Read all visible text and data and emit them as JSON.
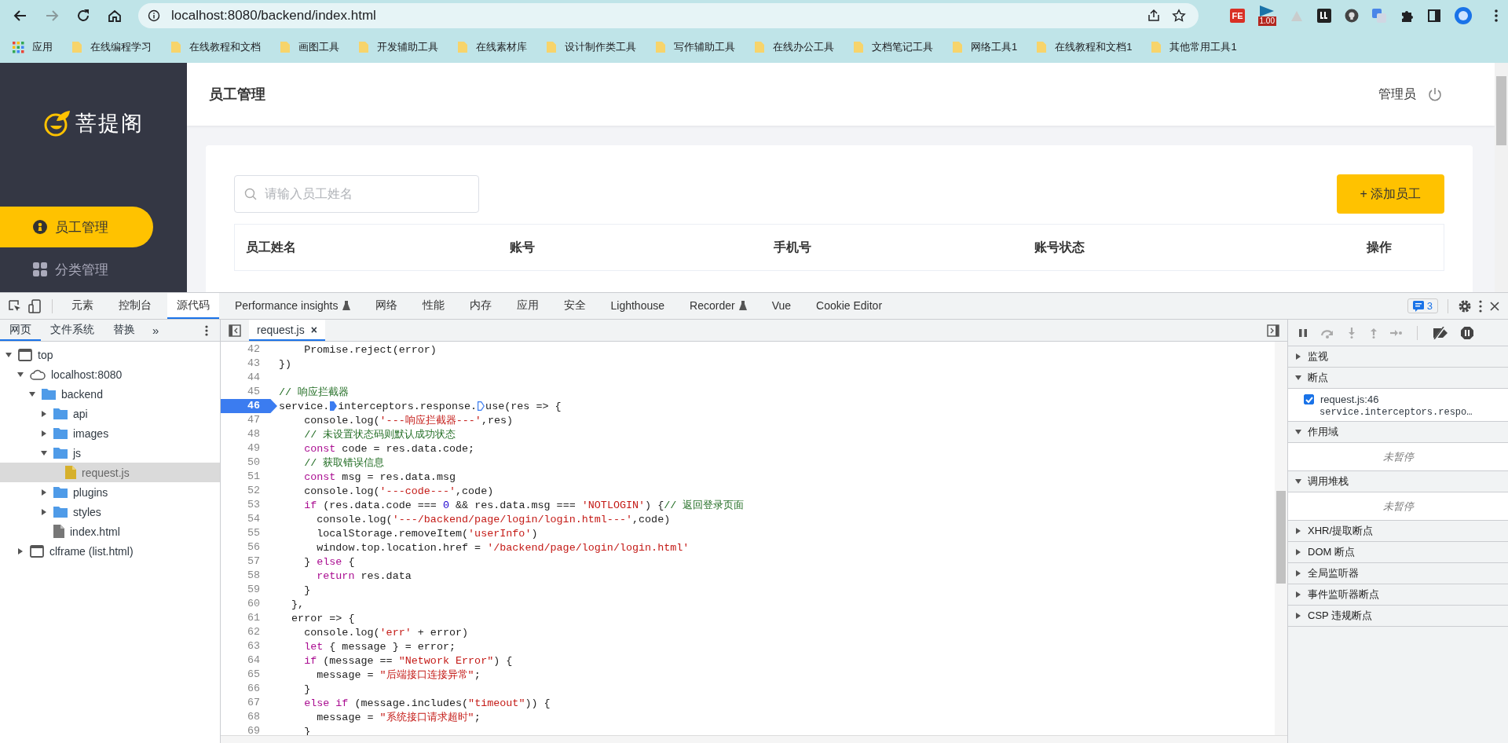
{
  "browser": {
    "nav_buttons": [
      {
        "kind": "back",
        "disabled": false
      },
      {
        "kind": "forward",
        "disabled": true
      },
      {
        "kind": "reload",
        "disabled": false
      },
      {
        "kind": "home",
        "disabled": false
      }
    ],
    "url": "localhost:8080/backend/index.html",
    "extensions": [
      {
        "kind": "fe",
        "label": "FE"
      },
      {
        "kind": "meter",
        "badge": "1.00"
      },
      {
        "kind": "triangle"
      },
      {
        "kind": "square"
      },
      {
        "kind": "bulb"
      },
      {
        "kind": "translate"
      },
      {
        "kind": "puzzle"
      },
      {
        "kind": "sidebar"
      },
      {
        "kind": "profile"
      }
    ],
    "bookmarks": {
      "apps_label": "应用",
      "folders": [
        "在线编程学习",
        "在线教程和文档",
        "画图工具",
        "开发辅助工具",
        "在线素材库",
        "设计制作类工具",
        "写作辅助工具",
        "在线办公工具",
        "文档笔记工具",
        "网络工具1",
        "在线教程和文档1",
        "其他常用工具1"
      ]
    }
  },
  "app": {
    "logo": "菩提阁",
    "nav": [
      {
        "label": "员工管理",
        "selected": true
      },
      {
        "label": "分类管理",
        "selected": false
      }
    ],
    "page_title": "员工管理",
    "user": "管理员",
    "search": {
      "placeholder": "请输入员工姓名"
    },
    "add_button": "+ 添加员工",
    "table": {
      "columns": [
        "员工姓名",
        "账号",
        "手机号",
        "账号状态",
        "操作"
      ]
    }
  },
  "devtools": {
    "tabs": [
      {
        "label": "元素",
        "selected": false,
        "experimental": false
      },
      {
        "label": "控制台",
        "selected": false,
        "experimental": false
      },
      {
        "label": "源代码",
        "selected": true,
        "experimental": false
      },
      {
        "label": "Performance insights",
        "selected": false,
        "experimental": true
      },
      {
        "label": "网络",
        "selected": false,
        "experimental": false
      },
      {
        "label": "性能",
        "selected": false,
        "experimental": false
      },
      {
        "label": "内存",
        "selected": false,
        "experimental": false
      },
      {
        "label": "应用",
        "selected": false,
        "experimental": false
      },
      {
        "label": "安全",
        "selected": false,
        "experimental": false
      },
      {
        "label": "Lighthouse",
        "selected": false,
        "experimental": false
      },
      {
        "label": "Recorder",
        "selected": false,
        "experimental": true
      },
      {
        "label": "Vue",
        "selected": false,
        "experimental": false
      },
      {
        "label": "Cookie Editor",
        "selected": false,
        "experimental": false
      }
    ],
    "issues_count": "3",
    "navigator": {
      "tabs": [
        {
          "label": "网页",
          "selected": true
        },
        {
          "label": "文件系统",
          "selected": false
        },
        {
          "label": "替换",
          "selected": false
        }
      ],
      "more": "»",
      "tree": [
        {
          "label": "top",
          "kind": "frame",
          "expanded": true,
          "selected": false,
          "children": [
            {
              "label": "localhost:8080",
              "kind": "origin",
              "expanded": true,
              "selected": false,
              "children": [
                {
                  "label": "backend",
                  "kind": "folder",
                  "expanded": true,
                  "selected": false,
                  "children": [
                    {
                      "label": "api",
                      "kind": "folder",
                      "expanded": false,
                      "selected": false
                    },
                    {
                      "label": "images",
                      "kind": "folder",
                      "expanded": false,
                      "selected": false
                    },
                    {
                      "label": "js",
                      "kind": "folder",
                      "expanded": true,
                      "selected": false,
                      "children": [
                        {
                          "label": "request.js",
                          "kind": "script",
                          "selected": true
                        }
                      ]
                    },
                    {
                      "label": "plugins",
                      "kind": "folder",
                      "expanded": false,
                      "selected": false
                    },
                    {
                      "label": "styles",
                      "kind": "folder",
                      "expanded": false,
                      "selected": false
                    },
                    {
                      "label": "index.html",
                      "kind": "file",
                      "selected": false
                    }
                  ]
                }
              ]
            },
            {
              "label": "clframe (list.html)",
              "kind": "frame",
              "expanded": false,
              "selected": false
            }
          ]
        }
      ]
    },
    "editor": {
      "tabs": [
        {
          "label": "request.js",
          "close": "×"
        }
      ],
      "lines": [
        {
          "number": "42",
          "breakpoint": false,
          "tokens": [
            {
              "kind": "plain",
              "text": "    Promise.reject(error)"
            }
          ]
        },
        {
          "number": "43",
          "breakpoint": false,
          "tokens": [
            {
              "kind": "plain",
              "text": "})"
            }
          ]
        },
        {
          "number": "44",
          "breakpoint": false
        },
        {
          "number": "45",
          "breakpoint": false,
          "tokens": [
            {
              "kind": "comment",
              "text": "// 响应拦截器"
            }
          ]
        },
        {
          "number": "46",
          "breakpoint": true,
          "tokens": [
            {
              "kind": "plain",
              "text": "service."
            },
            {
              "kind": "marker",
              "active": true
            },
            {
              "kind": "plain",
              "text": "interceptors.response."
            },
            {
              "kind": "marker",
              "active": false
            },
            {
              "kind": "plain",
              "text": "use(res => {"
            }
          ]
        },
        {
          "number": "47",
          "breakpoint": false,
          "tokens": [
            {
              "kind": "plain",
              "text": "    console.log("
            },
            {
              "kind": "string",
              "text": "'---响应拦截器---'"
            },
            {
              "kind": "plain",
              "text": ",res)"
            }
          ]
        },
        {
          "number": "48",
          "breakpoint": false,
          "tokens": [
            {
              "kind": "comment",
              "text": "    // 未设置状态码则默认成功状态"
            }
          ]
        },
        {
          "number": "49",
          "breakpoint": false,
          "tokens": [
            {
              "kind": "keyword",
              "text": "    const"
            },
            {
              "kind": "plain",
              "text": " code = res.data.code;"
            }
          ]
        },
        {
          "number": "50",
          "breakpoint": false,
          "tokens": [
            {
              "kind": "comment",
              "text": "    // 获取错误信息"
            }
          ]
        },
        {
          "number": "51",
          "breakpoint": false,
          "tokens": [
            {
              "kind": "keyword",
              "text": "    const"
            },
            {
              "kind": "plain",
              "text": " msg = res.data.msg"
            }
          ]
        },
        {
          "number": "52",
          "breakpoint": false,
          "tokens": [
            {
              "kind": "plain",
              "text": "    console.log("
            },
            {
              "kind": "string",
              "text": "'---code---'"
            },
            {
              "kind": "plain",
              "text": ",code)"
            }
          ]
        },
        {
          "number": "53",
          "breakpoint": false,
          "tokens": [
            {
              "kind": "keyword",
              "text": "    if"
            },
            {
              "kind": "plain",
              "text": " (res.data.code === "
            },
            {
              "kind": "number",
              "text": "0"
            },
            {
              "kind": "plain",
              "text": " && res.data.msg === "
            },
            {
              "kind": "string",
              "text": "'NOTLOGIN'"
            },
            {
              "kind": "plain",
              "text": ") {"
            },
            {
              "kind": "comment",
              "text": "// 返回登录页面"
            }
          ]
        },
        {
          "number": "54",
          "breakpoint": false,
          "tokens": [
            {
              "kind": "plain",
              "text": "      console.log("
            },
            {
              "kind": "string",
              "text": "'---/backend/page/login/login.html---'"
            },
            {
              "kind": "plain",
              "text": ",code)"
            }
          ]
        },
        {
          "number": "55",
          "breakpoint": false,
          "tokens": [
            {
              "kind": "plain",
              "text": "      localStorage.removeItem("
            },
            {
              "kind": "string",
              "text": "'userInfo'"
            },
            {
              "kind": "plain",
              "text": ")"
            }
          ]
        },
        {
          "number": "56",
          "breakpoint": false,
          "tokens": [
            {
              "kind": "plain",
              "text": "      window.top.location.href = "
            },
            {
              "kind": "string",
              "text": "'/backend/page/login/login.html'"
            }
          ]
        },
        {
          "number": "57",
          "breakpoint": false,
          "tokens": [
            {
              "kind": "plain",
              "text": "    } "
            },
            {
              "kind": "keyword",
              "text": "else"
            },
            {
              "kind": "plain",
              "text": " {"
            }
          ]
        },
        {
          "number": "58",
          "breakpoint": false,
          "tokens": [
            {
              "kind": "keyword",
              "text": "      return"
            },
            {
              "kind": "plain",
              "text": " res.data"
            }
          ]
        },
        {
          "number": "59",
          "breakpoint": false,
          "tokens": [
            {
              "kind": "plain",
              "text": "    }"
            }
          ]
        },
        {
          "number": "60",
          "breakpoint": false,
          "tokens": [
            {
              "kind": "plain",
              "text": "  },"
            }
          ]
        },
        {
          "number": "61",
          "breakpoint": false,
          "tokens": [
            {
              "kind": "plain",
              "text": "  error => {"
            }
          ]
        },
        {
          "number": "62",
          "breakpoint": false,
          "tokens": [
            {
              "kind": "plain",
              "text": "    console.log("
            },
            {
              "kind": "string",
              "text": "'err'"
            },
            {
              "kind": "plain",
              "text": " + error)"
            }
          ]
        },
        {
          "number": "63",
          "breakpoint": false,
          "tokens": [
            {
              "kind": "keyword",
              "text": "    let"
            },
            {
              "kind": "plain",
              "text": " { message } = error;"
            }
          ]
        },
        {
          "number": "64",
          "breakpoint": false,
          "tokens": [
            {
              "kind": "keyword",
              "text": "    if"
            },
            {
              "kind": "plain",
              "text": " (message == "
            },
            {
              "kind": "string",
              "text": "\"Network Error\""
            },
            {
              "kind": "plain",
              "text": ") {"
            }
          ]
        },
        {
          "number": "65",
          "breakpoint": false,
          "tokens": [
            {
              "kind": "plain",
              "text": "      message = "
            },
            {
              "kind": "string",
              "text": "\"后端接口连接异常\""
            },
            {
              "kind": "plain",
              "text": ";"
            }
          ]
        },
        {
          "number": "66",
          "breakpoint": false,
          "tokens": [
            {
              "kind": "plain",
              "text": "    }"
            }
          ]
        },
        {
          "number": "67",
          "breakpoint": false,
          "tokens": [
            {
              "kind": "keyword",
              "text": "    else if"
            },
            {
              "kind": "plain",
              "text": " (message.includes("
            },
            {
              "kind": "string",
              "text": "\"timeout\""
            },
            {
              "kind": "plain",
              "text": ")) {"
            }
          ]
        },
        {
          "number": "68",
          "breakpoint": false,
          "tokens": [
            {
              "kind": "plain",
              "text": "      message = "
            },
            {
              "kind": "string",
              "text": "\"系统接口请求超时\""
            },
            {
              "kind": "plain",
              "text": ";"
            }
          ]
        },
        {
          "number": "69",
          "breakpoint": false,
          "tokens": [
            {
              "kind": "plain",
              "text": "    }"
            }
          ]
        }
      ]
    },
    "debugger": {
      "sections": [
        {
          "title": "监视",
          "expanded": false
        },
        {
          "title": "断点",
          "expanded": true,
          "breakpoints": [
            {
              "file": "request.js:46",
              "code": "service.interceptors.respo…",
              "checked": true
            }
          ]
        },
        {
          "title": "作用域",
          "expanded": true,
          "message": "未暂停"
        },
        {
          "title": "调用堆栈",
          "expanded": true,
          "message": "未暂停"
        },
        {
          "title": "XHR/提取断点",
          "expanded": false
        },
        {
          "title": "DOM 断点",
          "expanded": false
        },
        {
          "title": "全局监听器",
          "expanded": false
        },
        {
          "title": "事件监听器断点",
          "expanded": false
        },
        {
          "title": "CSP 违规断点",
          "expanded": false
        }
      ]
    }
  }
}
